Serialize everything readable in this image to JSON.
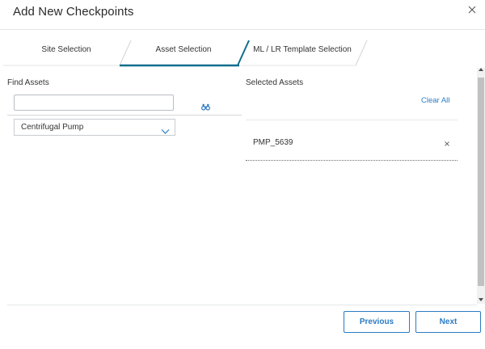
{
  "dialog": {
    "title": "Add New Checkpoints"
  },
  "wizard": {
    "steps": [
      {
        "label": "Site Selection",
        "active": false
      },
      {
        "label": "Asset Selection",
        "active": true
      },
      {
        "label": "ML / LR Template Selection",
        "active": false
      }
    ]
  },
  "find_assets": {
    "label": "Find Assets",
    "search_value": "",
    "search_icon": "binoculars-icon",
    "asset_type": "Centrifugal Pump"
  },
  "selected_assets": {
    "label": "Selected Assets",
    "clear_all_label": "Clear All",
    "items": [
      {
        "name": "PMP_5639"
      }
    ]
  },
  "footer": {
    "previous_label": "Previous",
    "next_label": "Next"
  },
  "colors": {
    "accent": "#2b7bc4",
    "active_step_underline": "#0f6e8c"
  }
}
